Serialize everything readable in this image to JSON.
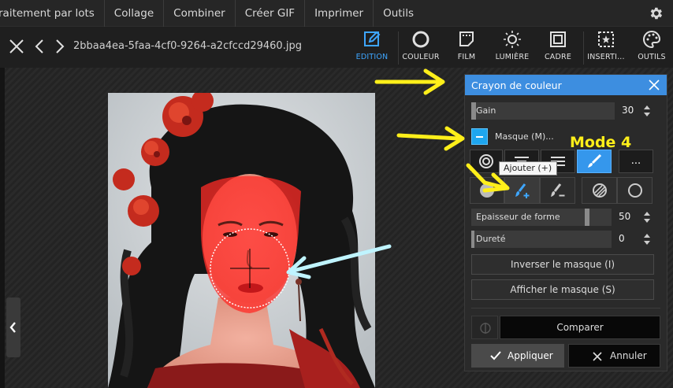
{
  "menubar": {
    "items": [
      "raitement par lots",
      "Collage",
      "Combiner",
      "Créer GIF",
      "Imprimer",
      "Outils"
    ]
  },
  "toolbar": {
    "filename": "2bbaa4ea-5faa-4cf0-9264-a2cfccd29460.jpg",
    "tools": [
      {
        "label": "EDITION",
        "icon": "edit-icon",
        "active": true
      },
      {
        "label": "COULEUR",
        "icon": "color-icon"
      },
      {
        "label": "FILM",
        "icon": "film-icon"
      },
      {
        "label": "LUMIÈRE",
        "icon": "light-icon"
      },
      {
        "label": "CADRE",
        "icon": "frame-icon"
      },
      {
        "label": "INSERTI...",
        "icon": "insert-icon"
      },
      {
        "label": "OUTILS",
        "icon": "palette-icon"
      }
    ]
  },
  "panel": {
    "title": "Crayon de couleur",
    "gain_label": "Gain",
    "gain_value": "30",
    "mask_label": "Masque (M)...",
    "shape_thickness_label": "Epaisseur de forme",
    "shape_thickness_value": "50",
    "hardness_label": "Dureté",
    "hardness_value": "0",
    "invert_mask_label": "Inverser le masque (I)",
    "show_mask_label": "Afficher le masque (S)",
    "compare_label": "Comparer",
    "apply_label": "Appliquer",
    "cancel_label": "Annuler",
    "more_label": "..."
  },
  "tooltip": {
    "text": "Ajouter (+)"
  },
  "annotation": {
    "text": "Mode 4"
  },
  "colors": {
    "accent": "#3597ec",
    "panel_header": "#3d8ee0",
    "annotation_yellow": "#ffef1a",
    "annotation_cyan": "#bff4ff"
  }
}
